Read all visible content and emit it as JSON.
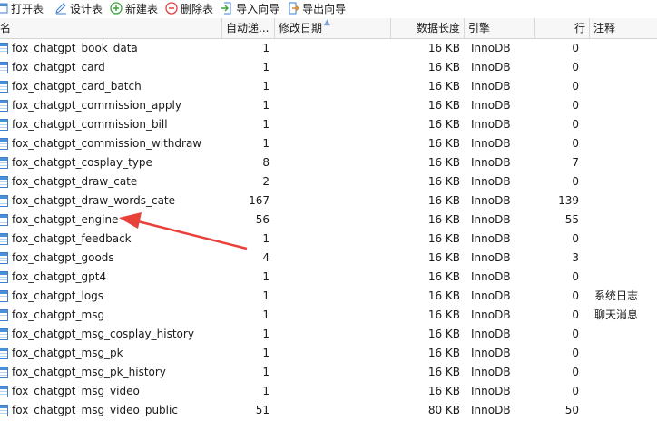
{
  "toolbar": {
    "open_label": "打开表",
    "design_label": "设计表",
    "new_label": "新建表",
    "delete_label": "删除表",
    "import_label": "导入向导",
    "export_label": "导出向导"
  },
  "columns": {
    "name": "名",
    "auto_increment": "自动递...",
    "modified_date": "修改日期",
    "data_length": "数据长度",
    "engine": "引擎",
    "rows": "行",
    "comment": "注释"
  },
  "tables": [
    {
      "name": "fox_chatgpt_book_data",
      "auto_increment": "1",
      "modified": "",
      "data_length": "16 KB",
      "engine": "InnoDB",
      "rows": "0",
      "comment": ""
    },
    {
      "name": "fox_chatgpt_card",
      "auto_increment": "1",
      "modified": "",
      "data_length": "16 KB",
      "engine": "InnoDB",
      "rows": "0",
      "comment": ""
    },
    {
      "name": "fox_chatgpt_card_batch",
      "auto_increment": "1",
      "modified": "",
      "data_length": "16 KB",
      "engine": "InnoDB",
      "rows": "0",
      "comment": ""
    },
    {
      "name": "fox_chatgpt_commission_apply",
      "auto_increment": "1",
      "modified": "",
      "data_length": "16 KB",
      "engine": "InnoDB",
      "rows": "0",
      "comment": ""
    },
    {
      "name": "fox_chatgpt_commission_bill",
      "auto_increment": "1",
      "modified": "",
      "data_length": "16 KB",
      "engine": "InnoDB",
      "rows": "0",
      "comment": ""
    },
    {
      "name": "fox_chatgpt_commission_withdraw",
      "auto_increment": "1",
      "modified": "",
      "data_length": "16 KB",
      "engine": "InnoDB",
      "rows": "0",
      "comment": ""
    },
    {
      "name": "fox_chatgpt_cosplay_type",
      "auto_increment": "8",
      "modified": "",
      "data_length": "16 KB",
      "engine": "InnoDB",
      "rows": "7",
      "comment": ""
    },
    {
      "name": "fox_chatgpt_draw_cate",
      "auto_increment": "2",
      "modified": "",
      "data_length": "16 KB",
      "engine": "InnoDB",
      "rows": "0",
      "comment": ""
    },
    {
      "name": "fox_chatgpt_draw_words_cate",
      "auto_increment": "167",
      "modified": "",
      "data_length": "16 KB",
      "engine": "InnoDB",
      "rows": "139",
      "comment": ""
    },
    {
      "name": "fox_chatgpt_engine",
      "auto_increment": "56",
      "modified": "",
      "data_length": "16 KB",
      "engine": "InnoDB",
      "rows": "55",
      "comment": ""
    },
    {
      "name": "fox_chatgpt_feedback",
      "auto_increment": "1",
      "modified": "",
      "data_length": "16 KB",
      "engine": "InnoDB",
      "rows": "0",
      "comment": ""
    },
    {
      "name": "fox_chatgpt_goods",
      "auto_increment": "4",
      "modified": "",
      "data_length": "16 KB",
      "engine": "InnoDB",
      "rows": "3",
      "comment": ""
    },
    {
      "name": "fox_chatgpt_gpt4",
      "auto_increment": "1",
      "modified": "",
      "data_length": "16 KB",
      "engine": "InnoDB",
      "rows": "0",
      "comment": ""
    },
    {
      "name": "fox_chatgpt_logs",
      "auto_increment": "1",
      "modified": "",
      "data_length": "16 KB",
      "engine": "InnoDB",
      "rows": "0",
      "comment": "系统日志"
    },
    {
      "name": "fox_chatgpt_msg",
      "auto_increment": "1",
      "modified": "",
      "data_length": "16 KB",
      "engine": "InnoDB",
      "rows": "0",
      "comment": "聊天消息"
    },
    {
      "name": "fox_chatgpt_msg_cosplay_history",
      "auto_increment": "1",
      "modified": "",
      "data_length": "16 KB",
      "engine": "InnoDB",
      "rows": "0",
      "comment": ""
    },
    {
      "name": "fox_chatgpt_msg_pk",
      "auto_increment": "1",
      "modified": "",
      "data_length": "16 KB",
      "engine": "InnoDB",
      "rows": "0",
      "comment": ""
    },
    {
      "name": "fox_chatgpt_msg_pk_history",
      "auto_increment": "1",
      "modified": "",
      "data_length": "16 KB",
      "engine": "InnoDB",
      "rows": "0",
      "comment": ""
    },
    {
      "name": "fox_chatgpt_msg_video",
      "auto_increment": "1",
      "modified": "",
      "data_length": "16 KB",
      "engine": "InnoDB",
      "rows": "0",
      "comment": ""
    },
    {
      "name": "fox_chatgpt_msg_video_public",
      "auto_increment": "51",
      "modified": "",
      "data_length": "80 KB",
      "engine": "InnoDB",
      "rows": "50",
      "comment": ""
    }
  ],
  "icons": {
    "table": "table-icon",
    "open": "open-table-icon",
    "design": "design-table-icon",
    "new": "new-table-icon",
    "delete": "delete-table-icon",
    "import": "import-wizard-icon",
    "export": "export-wizard-icon"
  },
  "colors": {
    "annotation_arrow": "#e8413a",
    "table_icon": "#4b8fd8",
    "new_icon": "#3aa53a",
    "delete_icon": "#e04040"
  }
}
